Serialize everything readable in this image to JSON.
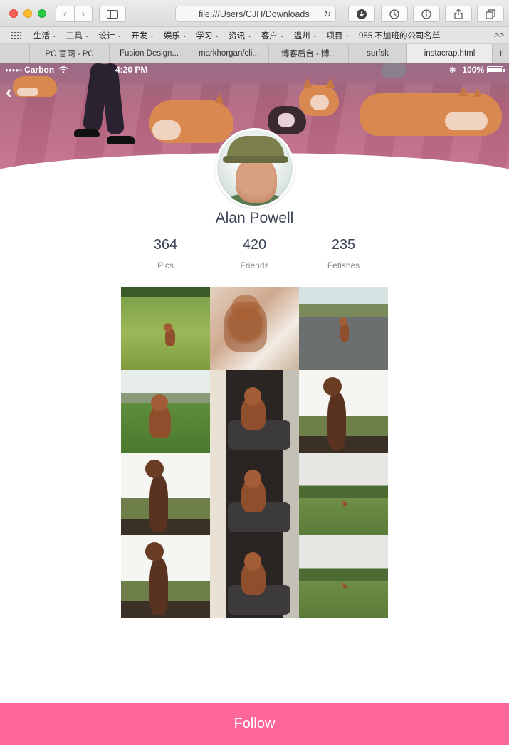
{
  "browser": {
    "address": "file:///Users/CJH/Downloads",
    "bookmarks": [
      "生活",
      "工具",
      "设计",
      "开发",
      "娱乐",
      "学习",
      "资讯",
      "客户",
      "温州",
      "项目"
    ],
    "bookmark_last": "955 不加班的公司名单",
    "bookmark_more": ">>",
    "tabs": [
      "PC 官网 - PC",
      "Fusion Design...",
      "markhorgan/cli...",
      "博客后台 - 博...",
      "surfsk",
      "instacrap.html"
    ]
  },
  "status_bar": {
    "carrier": "Carbon",
    "time": "4:20 PM",
    "battery": "100%"
  },
  "profile": {
    "name": "Alan Powell",
    "stats": [
      {
        "value": "364",
        "label": "Pics"
      },
      {
        "value": "420",
        "label": "Friends"
      },
      {
        "value": "235",
        "label": "Fetishes"
      }
    ]
  },
  "photos": [
    "grass",
    "blur",
    "path",
    "river",
    "bed",
    "sky",
    "sky",
    "bed",
    "field",
    "sky",
    "bed",
    "field"
  ],
  "follow_label": "Follow",
  "colors": {
    "accent": "#ff6699",
    "name_text": "#3a4455"
  }
}
